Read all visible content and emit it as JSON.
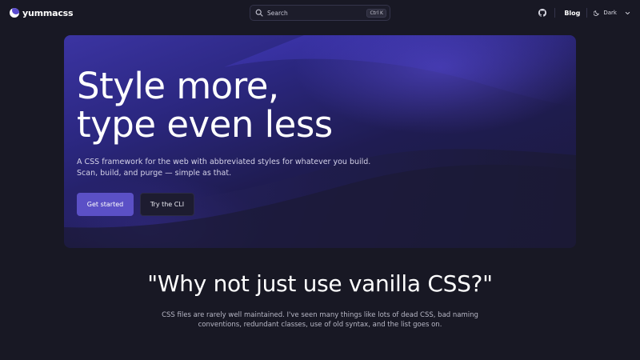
{
  "header": {
    "logo_text": "yummacss",
    "search": {
      "placeholder": "Search",
      "shortcut": "Ctrl K"
    },
    "nav": {
      "github_icon": "github-icon",
      "blog_label": "Blog",
      "theme_label": "Dark",
      "theme_icon": "moon-icon"
    }
  },
  "hero": {
    "title_line1": "Style more,",
    "title_line2": "type even less",
    "description": "A CSS framework for the web with abbreviated styles for whatever you build. Scan, build, and purge — simple as that.",
    "primary_button": "Get started",
    "secondary_button": "Try the CLI"
  },
  "section": {
    "heading": "\"Why not just use vanilla CSS?\"",
    "body": "CSS files are rarely well maintained. I've seen many things like lots of dead CSS, bad naming conventions, redundant classes, use of old syntax, and the list goes on."
  },
  "colors": {
    "background": "#181824",
    "accent": "#5b50c6",
    "hero_gradient_start": "#3b34a2",
    "hero_gradient_end": "#1b1a3a"
  }
}
